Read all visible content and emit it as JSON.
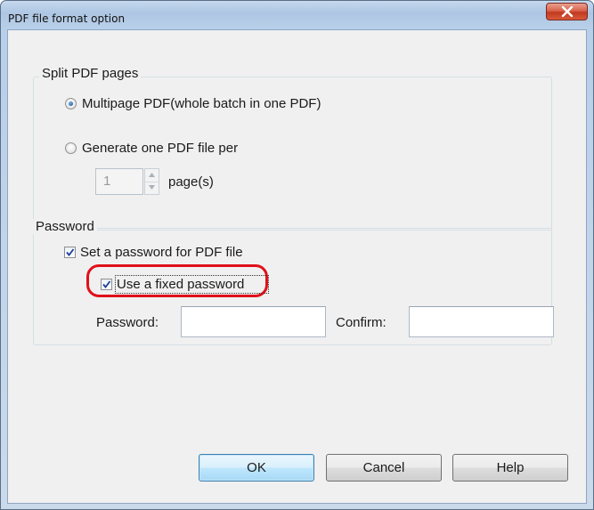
{
  "window": {
    "title": "PDF file format option",
    "close_icon": "close-icon"
  },
  "split_group": {
    "legend": "Split PDF pages",
    "option_multipage": "Multipage PDF(whole batch in one PDF)",
    "option_multipage_selected": true,
    "option_per_page": "Generate one PDF file per",
    "option_per_page_selected": false,
    "pages_value": "1",
    "pages_suffix": "page(s)"
  },
  "password_group": {
    "legend": "Password",
    "set_password_label": "Set a password for PDF file",
    "set_password_checked": true,
    "fixed_password_label": "Use a fixed password",
    "fixed_password_checked": true,
    "password_label": "Password:",
    "password_value": "",
    "confirm_label": "Confirm:",
    "confirm_value": "",
    "highlight_color": "#e0101a"
  },
  "buttons": {
    "ok": "OK",
    "cancel": "Cancel",
    "help": "Help"
  }
}
